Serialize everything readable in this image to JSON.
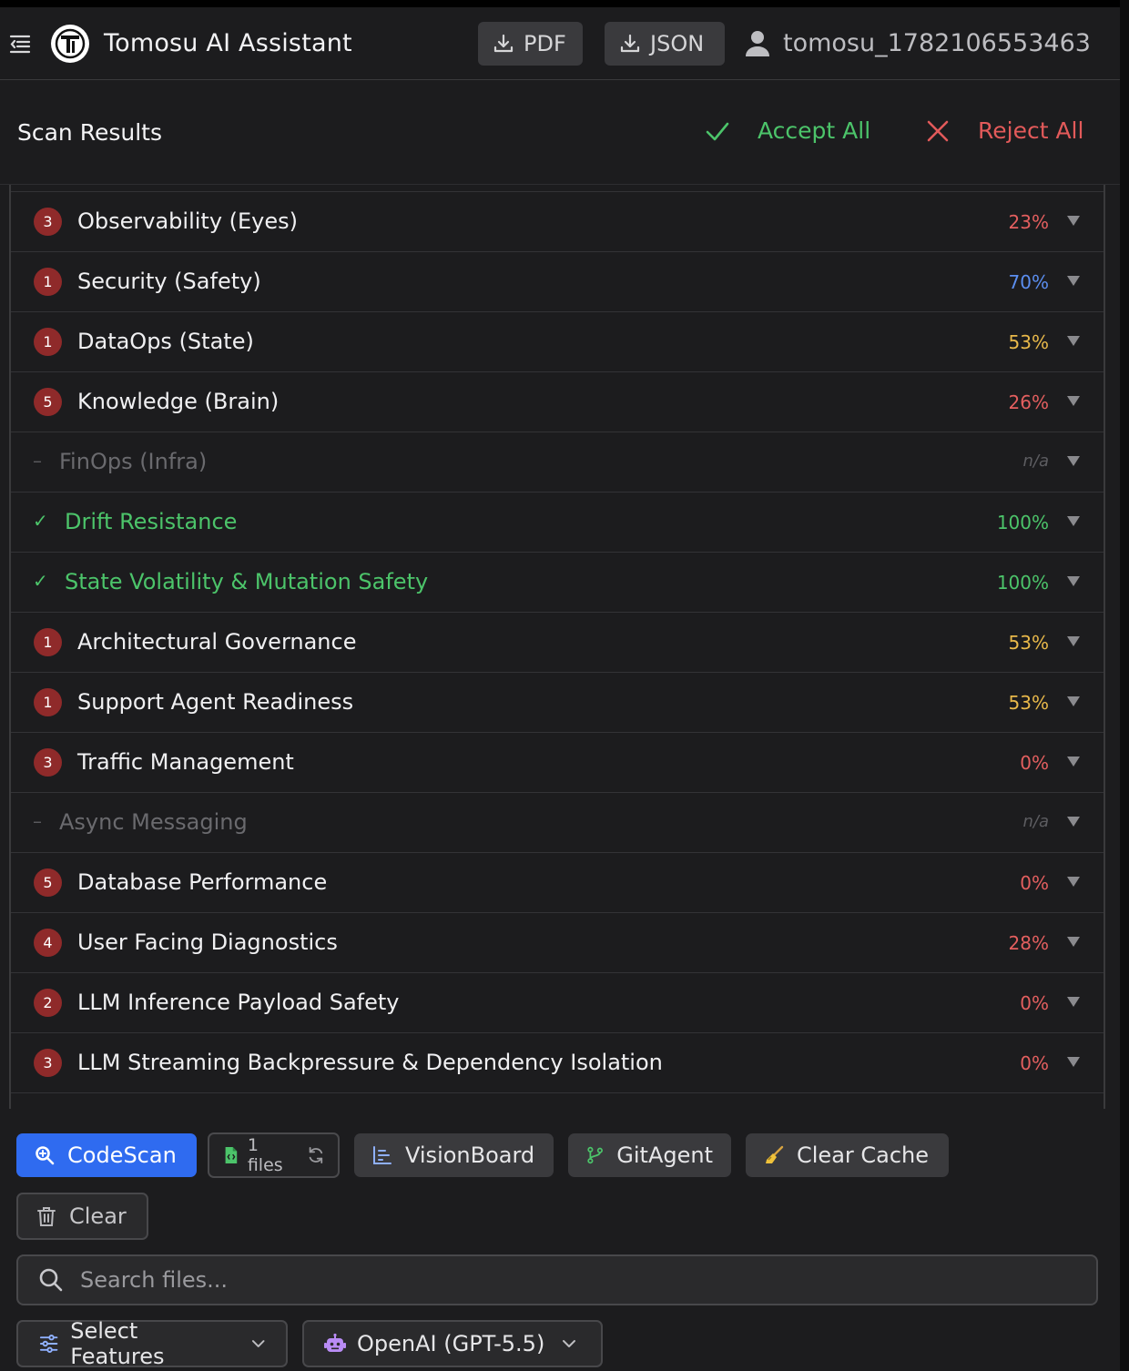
{
  "header": {
    "title": "Tomosu AI Assistant",
    "logo_letter": "T",
    "pdf_label": "PDF",
    "json_label": "JSON",
    "username": "tomosu_1782106553463"
  },
  "scan": {
    "title": "Scan Results",
    "accept_label": "Accept All",
    "reject_label": "Reject All"
  },
  "results": [
    {
      "status": "issues",
      "count": "3",
      "name": "Observability (Eyes)",
      "score": "23%",
      "tone": "red"
    },
    {
      "status": "issues",
      "count": "1",
      "name": "Security (Safety)",
      "score": "70%",
      "tone": "blue"
    },
    {
      "status": "issues",
      "count": "1",
      "name": "DataOps (State)",
      "score": "53%",
      "tone": "yellow"
    },
    {
      "status": "issues",
      "count": "5",
      "name": "Knowledge (Brain)",
      "score": "26%",
      "tone": "red"
    },
    {
      "status": "na",
      "count": "–",
      "name": "FinOps (Infra)",
      "score": "n/a",
      "tone": "na"
    },
    {
      "status": "ok",
      "count": "✓",
      "name": "Drift Resistance",
      "score": "100%",
      "tone": "green"
    },
    {
      "status": "ok",
      "count": "✓",
      "name": "State Volatility & Mutation Safety",
      "score": "100%",
      "tone": "green"
    },
    {
      "status": "issues",
      "count": "1",
      "name": "Architectural Governance",
      "score": "53%",
      "tone": "yellow"
    },
    {
      "status": "issues",
      "count": "1",
      "name": "Support Agent Readiness",
      "score": "53%",
      "tone": "yellow"
    },
    {
      "status": "issues",
      "count": "3",
      "name": "Traffic Management",
      "score": "0%",
      "tone": "red"
    },
    {
      "status": "na",
      "count": "–",
      "name": "Async Messaging",
      "score": "n/a",
      "tone": "na"
    },
    {
      "status": "issues",
      "count": "5",
      "name": "Database Performance",
      "score": "0%",
      "tone": "red"
    },
    {
      "status": "issues",
      "count": "4",
      "name": "User Facing Diagnostics",
      "score": "28%",
      "tone": "red"
    },
    {
      "status": "issues",
      "count": "2",
      "name": "LLM Inference Payload Safety",
      "score": "0%",
      "tone": "red"
    },
    {
      "status": "issues",
      "count": "3",
      "name": "LLM Streaming Backpressure & Dependency Isolation",
      "score": "0%",
      "tone": "red"
    }
  ],
  "toolbar": {
    "codescan_label": "CodeScan",
    "files_label": "1 files",
    "visionboard_label": "VisionBoard",
    "gitagent_label": "GitAgent",
    "clearcache_label": "Clear Cache",
    "clear_label": "Clear",
    "search_placeholder": "Search files...",
    "features_label": "Select Features",
    "model_label": "OpenAI (GPT-5.5)"
  },
  "colors": {
    "accent": "#2f6bf0",
    "success": "#4cc46a",
    "danger": "#e25a5a",
    "warning": "#e9b94a",
    "info": "#5b8ef0",
    "badge": "#8f2a2a"
  }
}
